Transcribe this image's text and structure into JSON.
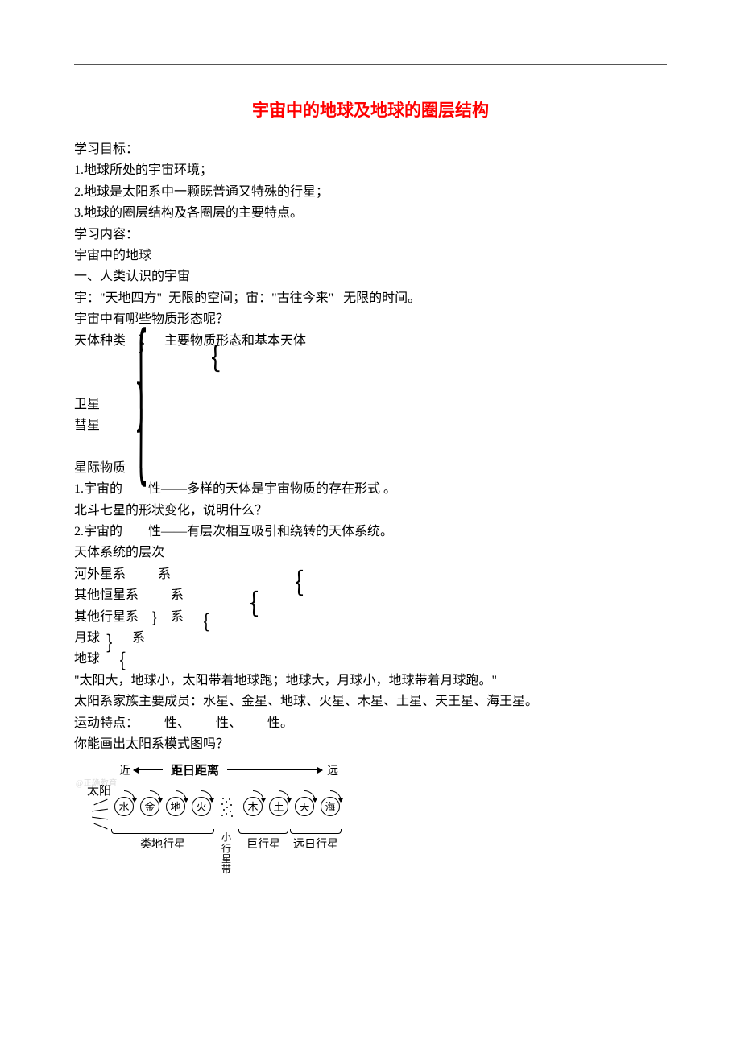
{
  "title": "宇宙中的地球及地球的圈层结构",
  "lines": {
    "a": "学习目标：",
    "b": "1.地球所处的宇宙环境；",
    "c": "2.地球是太阳系中一颗既普通又特殊的行星；",
    "d": "3.地球的圈层结构及各圈层的主要特点。",
    "e": "学习内容：",
    "f": "宇宙中的地球",
    "g": "一、人类认识的宇宙",
    "h": "宇：\"天地四方\"  无限的空间；宙：\"古往今来\"   无限的时间。",
    "i": "宇宙中有哪些物质形态呢？",
    "j": "天体种类            主要物质形态和基本天体",
    "k": "卫星",
    "l": "彗星",
    "m": "星际物质",
    "n": "1.宇宙的        性——多样的天体是宇宙物质的存在形式 。",
    "o": "北斗七星的形状变化，说明什么？",
    "p": "2.宇宙的        性——有层次相互吸引和绕转的天体系统。",
    "q": "天体系统的层次",
    "r": "河外星系          系",
    "s": "其他恒星系          系",
    "t": "其他行星系          系",
    "u": "月球          系",
    "v": "地球",
    "w": "\"太阳大，地球小，太阳带着地球跑；地球大，月球小，地球带着月球跑。\"",
    "x": "太阳系家族主要成员：水星、金星、地球、火星、木星、土星、天王星、海王星。",
    "y": "运动特点：        性、        性、        性。",
    "z": "你能画出太阳系模式图吗？"
  },
  "figure": {
    "watermark": "@正确教育",
    "sun_label": "太阳",
    "near": "近",
    "far": "远",
    "distance_label": "距日距离",
    "planets": [
      "水",
      "金",
      "地",
      "火",
      "木",
      "土",
      "天",
      "海"
    ],
    "asteroid_label": "小行星带",
    "groups": {
      "terrestrial": "类地行星",
      "giant": "巨行星",
      "outer": "远日行星"
    }
  }
}
